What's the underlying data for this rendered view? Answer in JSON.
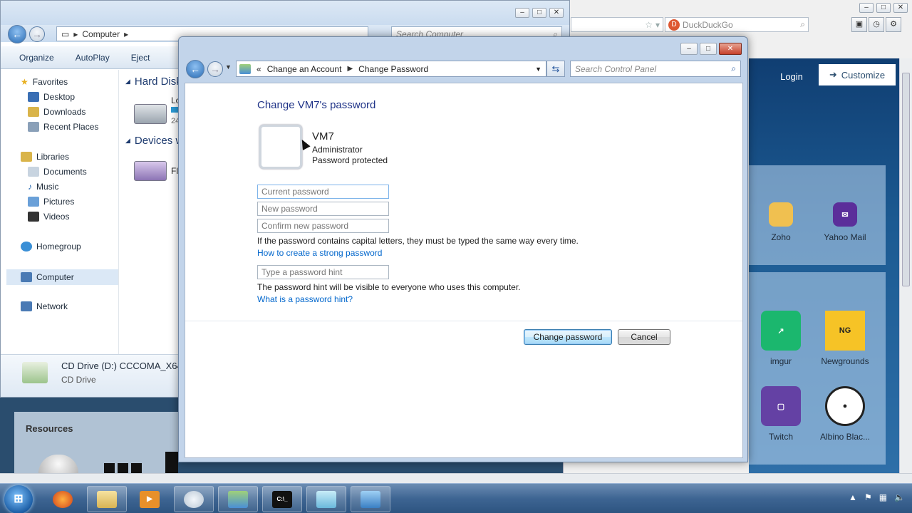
{
  "browser": {
    "search_engine": "DuckDuckGo",
    "login_label": "Login",
    "customize_label": "Customize",
    "tiles": [
      {
        "label": "Zoho",
        "icon": "zoho-icon",
        "color": "#f0c050"
      },
      {
        "label": "Yahoo Mail",
        "icon": "yahoo-mail-icon",
        "color": "#5b2e9a"
      },
      {
        "label": "imgur",
        "icon": "imgur-icon",
        "color": "#1bb76e"
      },
      {
        "label": "Newgrounds",
        "icon": "newgrounds-icon",
        "color": "#f6c326"
      },
      {
        "label": "Twitch",
        "icon": "twitch-icon",
        "color": "#6441a4"
      },
      {
        "label": "Albino Blac...",
        "icon": "albino-blacksheep-icon",
        "color": "#222222"
      }
    ]
  },
  "explorer": {
    "address": "Computer",
    "search_placeholder": "Search Computer",
    "toolbar": [
      "Organize",
      "AutoPlay",
      "Eject"
    ],
    "nav": {
      "favorites": "Favorites",
      "favorites_items": [
        "Desktop",
        "Downloads",
        "Recent Places"
      ],
      "libraries": "Libraries",
      "libraries_items": [
        "Documents",
        "Music",
        "Pictures",
        "Videos"
      ],
      "homegroup": "Homegroup",
      "computer": "Computer",
      "network": "Network"
    },
    "groups": [
      "Hard Disk",
      "Devices w"
    ],
    "drive_labels": [
      "Lo",
      "24",
      "Fl"
    ],
    "details": {
      "title": "CD Drive (D:) CCCOMA_X64F",
      "subtitle": "CD Drive"
    }
  },
  "resources": {
    "title": "Resources"
  },
  "control_panel": {
    "breadcrumb_prefix": "«",
    "breadcrumb": [
      "Change an Account",
      "Change Password"
    ],
    "search_placeholder": "Search Control Panel",
    "heading": "Change VM7's password",
    "user": {
      "name": "VM7",
      "role": "Administrator",
      "status": "Password protected"
    },
    "fields": {
      "current": "Current password",
      "new": "New password",
      "confirm": "Confirm new password",
      "hint": "Type a password hint"
    },
    "caps_note": "If the password contains capital letters, they must be typed the same way every time.",
    "strong_link": "How to create a strong password",
    "hint_note": "The password hint will be visible to everyone who uses this computer.",
    "hint_link": "What is a password hint?",
    "change_button": "Change password",
    "cancel_button": "Cancel"
  }
}
